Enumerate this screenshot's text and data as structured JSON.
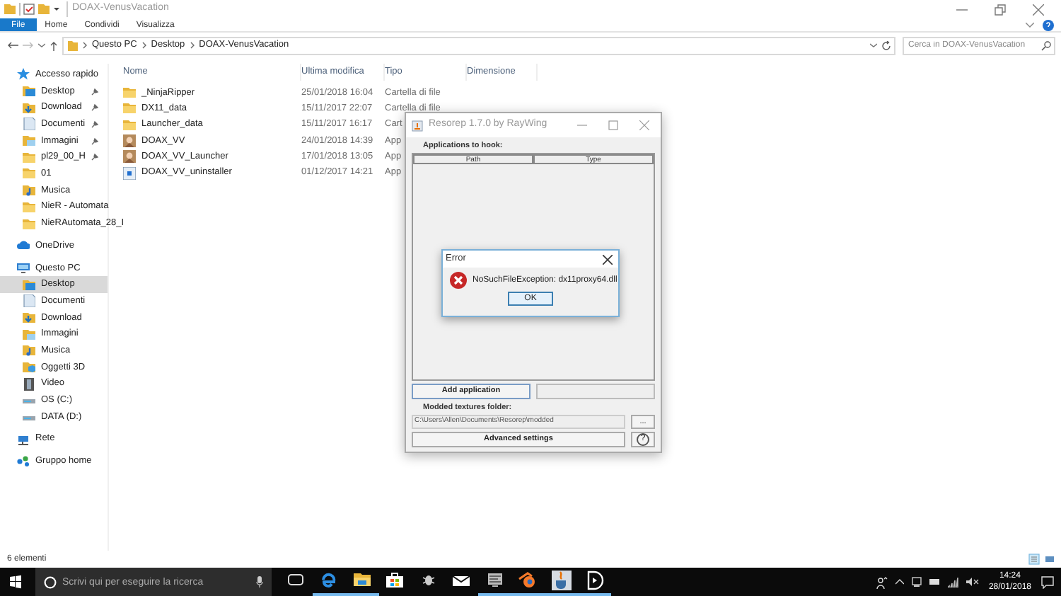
{
  "explorer": {
    "title": "DOAX-VenusVacation",
    "ribbon_tabs": [
      {
        "label": "File",
        "selected": true
      },
      {
        "label": "Home",
        "selected": false
      },
      {
        "label": "Condividi",
        "selected": false
      },
      {
        "label": "Visualizza",
        "selected": false
      }
    ],
    "breadcrumb": [
      "Questo PC",
      "Desktop",
      "DOAX-VenusVacation"
    ],
    "search": {
      "placeholder": "Cerca in DOAX-VenusVacation"
    },
    "columns": [
      "Nome",
      "Ultima modifica",
      "Tipo",
      "Dimensione"
    ],
    "files": [
      {
        "name": "_NinjaRipper",
        "modified": "25/01/2018 16:04",
        "type": "Cartella di file",
        "kind": "folder"
      },
      {
        "name": "DX11_data",
        "modified": "15/11/2017 22:07",
        "type": "Cartella di file",
        "kind": "folder"
      },
      {
        "name": "Launcher_data",
        "modified": "15/11/2017 16:17",
        "type": "Cart",
        "kind": "folder"
      },
      {
        "name": "DOAX_VV",
        "modified": "24/01/2018 14:39",
        "type": "App",
        "kind": "app"
      },
      {
        "name": "DOAX_VV_Launcher",
        "modified": "17/01/2018 13:05",
        "type": "App",
        "kind": "app"
      },
      {
        "name": "DOAX_VV_uninstaller",
        "modified": "01/12/2017 14:21",
        "type": "App",
        "kind": "setup"
      }
    ],
    "sidebar": [
      {
        "label": "Accesso rapido",
        "kind": "star",
        "selected": false,
        "children": [
          {
            "label": "Desktop",
            "kind": "desktop",
            "pinned": true,
            "selected": false
          },
          {
            "label": "Download",
            "kind": "download",
            "pinned": true,
            "selected": false
          },
          {
            "label": "Documenti",
            "kind": "document",
            "pinned": true,
            "selected": false
          },
          {
            "label": "Immagini",
            "kind": "picture",
            "pinned": true,
            "selected": false
          },
          {
            "label": "pl29_00_H",
            "kind": "folder",
            "pinned": true,
            "selected": false
          },
          {
            "label": "01",
            "kind": "folder",
            "pinned": false,
            "selected": false
          },
          {
            "label": "Musica",
            "kind": "music",
            "pinned": false,
            "selected": false
          },
          {
            "label": "NieR - Automata",
            "kind": "folder",
            "pinned": false,
            "selected": false
          },
          {
            "label": "NieRAutomata_28_I",
            "kind": "folder",
            "pinned": false,
            "selected": false
          }
        ]
      },
      {
        "label": "OneDrive",
        "kind": "cloud",
        "selected": false
      },
      {
        "label": "Questo PC",
        "kind": "pc",
        "selected": false,
        "children": [
          {
            "label": "Desktop",
            "kind": "desktop",
            "pinned": false,
            "selected": true
          },
          {
            "label": "Documenti",
            "kind": "document",
            "pinned": false,
            "selected": false
          },
          {
            "label": "Download",
            "kind": "download",
            "pinned": false,
            "selected": false
          },
          {
            "label": "Immagini",
            "kind": "picture",
            "pinned": false,
            "selected": false
          },
          {
            "label": "Musica",
            "kind": "music",
            "pinned": false,
            "selected": false
          },
          {
            "label": "Oggetti 3D",
            "kind": "cube",
            "pinned": false,
            "selected": false
          },
          {
            "label": "Video",
            "kind": "video",
            "pinned": false,
            "selected": false
          },
          {
            "label": "OS (C:)",
            "kind": "drive",
            "pinned": false,
            "selected": false
          },
          {
            "label": "DATA (D:)",
            "kind": "drive",
            "pinned": false,
            "selected": false
          }
        ]
      },
      {
        "label": "Rete",
        "kind": "network",
        "selected": false
      },
      {
        "label": "Gruppo home",
        "kind": "homegroup",
        "selected": false
      }
    ],
    "status": "6 elementi"
  },
  "resorep": {
    "title": "Resorep 1.7.0 by RayWing",
    "apps_label": "Applications to hook:",
    "columns": [
      "Path",
      "Type"
    ],
    "add_button": "Add application",
    "folder_label": "Modded textures folder:",
    "folder_path": "C:\\Users\\Allen\\Documents\\Resorep\\modded",
    "browse_button": "...",
    "advanced_button": "Advanced settings",
    "help_button": "?"
  },
  "error_dialog": {
    "title": "Error",
    "message": "NoSuchFileException: dx11proxy64.dll",
    "ok_button": "OK"
  },
  "taskbar": {
    "search_placeholder": "Scrivi qui per eseguire la ricerca",
    "apps": [
      {
        "kind": "taskview",
        "running": false
      },
      {
        "kind": "edge",
        "running": true
      },
      {
        "kind": "explorer",
        "running": true
      },
      {
        "kind": "store",
        "running": false
      },
      {
        "kind": "bug",
        "running": false
      },
      {
        "kind": "mail",
        "running": false
      },
      {
        "kind": "monitor",
        "running": true
      },
      {
        "kind": "blender",
        "running": true
      },
      {
        "kind": "java",
        "running": true
      },
      {
        "kind": "d",
        "running": true
      }
    ],
    "time": "14:24",
    "date": "28/01/2018"
  }
}
